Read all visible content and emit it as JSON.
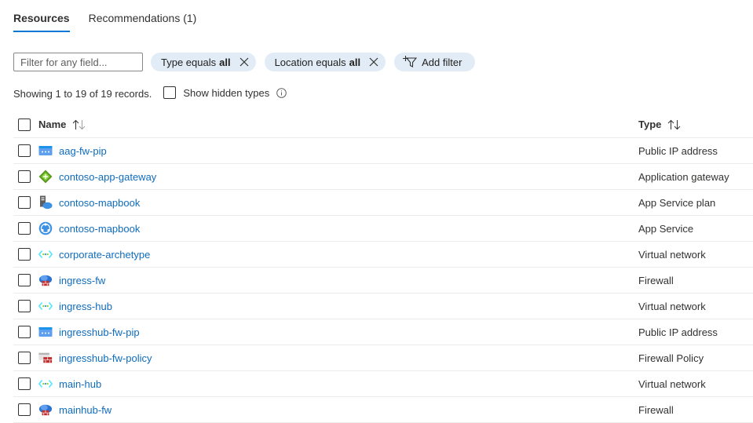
{
  "tabs": [
    {
      "label": "Resources",
      "active": true
    },
    {
      "label": "Recommendations (1)",
      "active": false
    }
  ],
  "filter": {
    "placeholder": "Filter for any field...",
    "value": "",
    "pills": [
      {
        "prefix": "Type equals",
        "value": "all"
      },
      {
        "prefix": "Location equals",
        "value": "all"
      }
    ],
    "add_filter_label": "Add filter"
  },
  "records": {
    "text": "Showing 1 to 19 of 19 records.",
    "show_hidden_label": "Show hidden types"
  },
  "table": {
    "columns": {
      "name": "Name",
      "type": "Type"
    },
    "rows": [
      {
        "name": "aag-fw-pip",
        "type": "Public IP address",
        "icon": "public-ip-icon"
      },
      {
        "name": "contoso-app-gateway",
        "type": "Application gateway",
        "icon": "app-gateway-icon"
      },
      {
        "name": "contoso-mapbook",
        "type": "App Service plan",
        "icon": "app-service-plan-icon"
      },
      {
        "name": "contoso-mapbook",
        "type": "App Service",
        "icon": "app-service-icon"
      },
      {
        "name": "corporate-archetype",
        "type": "Virtual network",
        "icon": "virtual-network-icon"
      },
      {
        "name": "ingress-fw",
        "type": "Firewall",
        "icon": "firewall-icon"
      },
      {
        "name": "ingress-hub",
        "type": "Virtual network",
        "icon": "virtual-network-icon"
      },
      {
        "name": "ingresshub-fw-pip",
        "type": "Public IP address",
        "icon": "public-ip-icon"
      },
      {
        "name": "ingresshub-fw-policy",
        "type": "Firewall Policy",
        "icon": "firewall-policy-icon"
      },
      {
        "name": "main-hub",
        "type": "Virtual network",
        "icon": "virtual-network-icon"
      },
      {
        "name": "mainhub-fw",
        "type": "Firewall",
        "icon": "firewall-icon"
      }
    ]
  },
  "colors": {
    "accent": "#0078d4",
    "link": "#0f6cbd",
    "pill_bg": "#e1ecf7",
    "divider": "#edebe9"
  }
}
